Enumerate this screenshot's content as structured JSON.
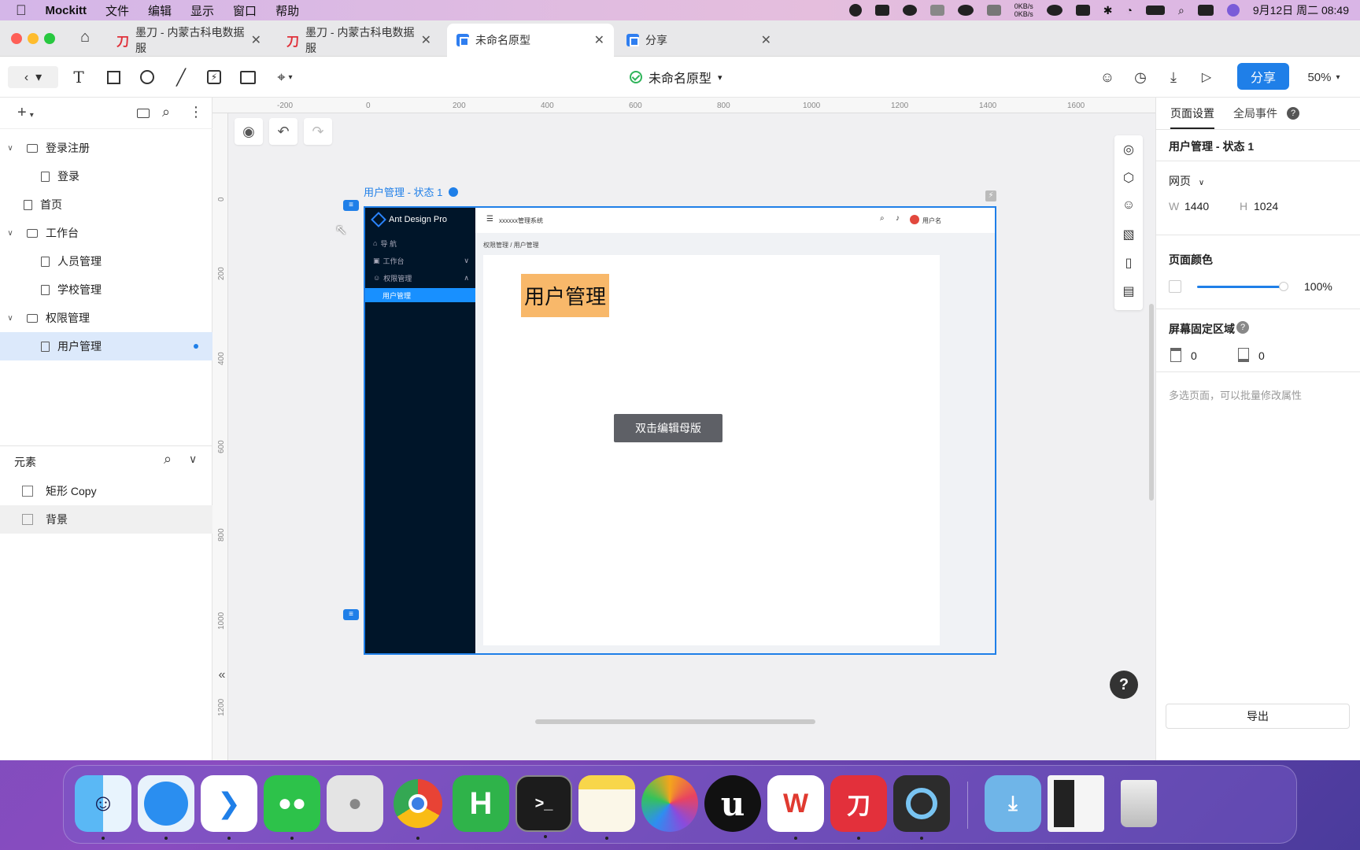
{
  "menubar": {
    "app_name": "Mockitt",
    "items": [
      "文件",
      "编辑",
      "显示",
      "窗口",
      "帮助"
    ],
    "net_up": "0KB/s",
    "net_down": "0KB/s",
    "datetime": "9月12日 周二 08:49"
  },
  "tabs": [
    {
      "title": "墨刀 - 内蒙古科电数据服",
      "icon": "modao-logo-icon"
    },
    {
      "title": "墨刀 - 内蒙古科电数据服",
      "icon": "modao-logo-icon"
    },
    {
      "title": "未命名原型",
      "icon": "mockitt-logo-icon"
    },
    {
      "title": "分享",
      "icon": "mockitt-logo-icon"
    }
  ],
  "toolbar": {
    "doc_title": "未命名原型",
    "share_label": "分享",
    "zoom": "50%"
  },
  "pages": {
    "items": [
      {
        "label": "登录注册",
        "type": "folder",
        "level": 0,
        "expanded": true
      },
      {
        "label": "登录",
        "type": "page",
        "level": 1
      },
      {
        "label": "首页",
        "type": "page",
        "level": 0
      },
      {
        "label": "工作台",
        "type": "folder",
        "level": 0,
        "expanded": true
      },
      {
        "label": "人员管理",
        "type": "page",
        "level": 1
      },
      {
        "label": "学校管理",
        "type": "page",
        "level": 1
      },
      {
        "label": "权限管理",
        "type": "folder",
        "level": 0,
        "expanded": true
      },
      {
        "label": "用户管理",
        "type": "page",
        "level": 1,
        "selected": true
      }
    ]
  },
  "elements": {
    "header": "元素",
    "items": [
      {
        "label": "矩形 Copy",
        "icon": "rectangle-icon"
      },
      {
        "label": "背景",
        "icon": "master-icon"
      }
    ]
  },
  "canvas": {
    "ruler_h": [
      "-200",
      "0",
      "200",
      "400",
      "600",
      "800",
      "1000",
      "1200",
      "1400",
      "1600"
    ],
    "ruler_v": [
      "0",
      "200",
      "400",
      "600",
      "800",
      "1000",
      "1200"
    ],
    "frame_label": "用户管理 - 状态 1",
    "proto": {
      "logo": "Ant Design Pro",
      "menu": [
        "导 航",
        "工作台",
        "权限管理"
      ],
      "submenu_selected": "用户管理",
      "header_title": "xxxxxx管理系统",
      "user": "用户名",
      "breadcrumb": "权限管理 / 用户管理",
      "heading": "用户管理"
    },
    "edit_master_button": "双击编辑母版",
    "help": "?"
  },
  "right_panel": {
    "tabs": [
      "页面设置",
      "全局事件"
    ],
    "page_title": "用户管理 - 状态 1",
    "page_type": "网页",
    "w_label": "W",
    "w_value": "1440",
    "h_label": "H",
    "h_value": "1024",
    "color_title": "页面颜色",
    "opacity": "100%",
    "fixed_area_title": "屏幕固定区域",
    "fixed_top": "0",
    "fixed_bottom": "0",
    "multi_select_hint": "多选页面，可以批量修改属性",
    "export_label": "导出"
  },
  "dock": {
    "apps": [
      "Finder",
      "Safari",
      "VS Code",
      "WeChat",
      "Messages",
      "Chrome",
      "HBuilder",
      "Terminal",
      "Notes",
      "Photos",
      "Unreal",
      "WPS",
      "Modao",
      "QuickTime",
      "Downloads",
      "Screenshot",
      "Trash"
    ]
  }
}
